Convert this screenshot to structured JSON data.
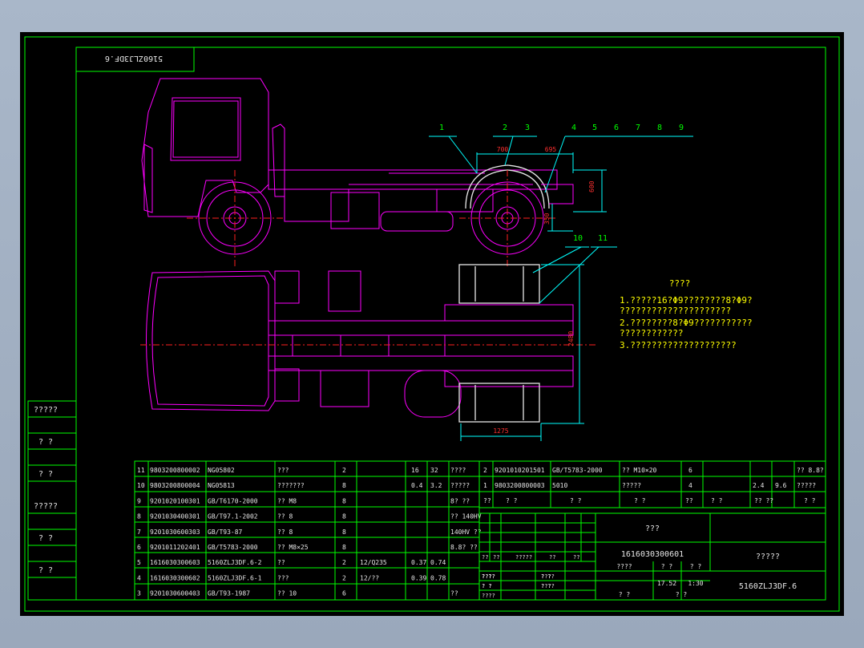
{
  "drawing_code_mirrored": "5160ZLJ3DF.6",
  "balloons_top": [
    "1",
    "2",
    "3",
    "4",
    "5",
    "6",
    "7",
    "8",
    "9"
  ],
  "balloons_plan": [
    "10",
    "11"
  ],
  "dims_side": [
    "700",
    "695",
    "600",
    "350"
  ],
  "dims_plan": [
    "2480",
    "1275"
  ],
  "notes": {
    "title": "????",
    "items": [
      "1.?????16?Φ9????????8?Φ9?",
      "  ?????????????????????",
      "2.????????8?Φ9???????????",
      "  ????????????",
      "3.????????????????????"
    ]
  },
  "left_strip": [
    "?????",
    "? ?",
    "? ?",
    "?????",
    "? ?",
    "? ?"
  ],
  "bom_left": [
    [
      "11",
      "9803200800002",
      "NG05802",
      "???",
      "2",
      "",
      "16",
      "32",
      "????"
    ],
    [
      "10",
      "9803200800004",
      "NG05813",
      "???????",
      "8",
      "",
      "0.4",
      "3.2",
      "?????"
    ],
    [
      "9",
      "9201020100301",
      "GB/T6170-2000",
      "?? M8",
      "8",
      "",
      "",
      "",
      "8? ??"
    ],
    [
      "8",
      "9201030400301",
      "GB/T97.1-2002",
      "?? 8",
      "8",
      "",
      "",
      "",
      "?? 140HV"
    ],
    [
      "7",
      "9201030600303",
      "GB/T93-87",
      "?? 8",
      "8",
      "",
      "",
      "",
      "140HV ??"
    ],
    [
      "6",
      "9201011202401",
      "GB/T5783-2000",
      "?? M8×25",
      "8",
      "",
      "",
      "",
      "8.8? ??"
    ],
    [
      "5",
      "1616030300603",
      "5160ZLJ3DF.6-2",
      "??",
      "2",
      "12/Q235",
      "0.37",
      "0.74",
      ""
    ],
    [
      "4",
      "1616030300602",
      "5160ZLJ3DF.6-1",
      "???",
      "2",
      "12/??",
      "0.39",
      "0.78",
      ""
    ],
    [
      "3",
      "9201030600403",
      "GB/T93-1987",
      "?? 10",
      "6",
      "",
      "",
      "",
      "??"
    ]
  ],
  "bom_right": [
    [
      "2",
      "9201010201501",
      "GB/T5783-2000",
      "?? M10×20",
      "6",
      "",
      "",
      "",
      "?? 8.8?"
    ],
    [
      "1",
      "9803200800003",
      "5010",
      "?????",
      "4",
      "",
      "2.4",
      "9.6",
      "?????"
    ],
    [
      "??",
      "? ?",
      "? ?",
      "? ?",
      "??",
      "? ?",
      "?? ??",
      "? ?"
    ]
  ],
  "title_block": {
    "name": "???",
    "part_no": "1616030300601",
    "company": "?????",
    "code": "5160ZLJ3DF.6",
    "weight": "17.52",
    "scale": "1:30",
    "labels_a": [
      "??",
      "??",
      "?????",
      "??",
      "??"
    ],
    "labels_b": [
      "? ?",
      "????",
      "? ?",
      "? ?",
      "????"
    ],
    "labels_c": [
      "????",
      "? ?",
      "? ?"
    ],
    "sheet": [
      "? ?",
      "? ?"
    ]
  },
  "colors": {
    "frame": "#00ff00",
    "truck": "#ff00ff",
    "leader": "#00ffff",
    "center": "#ff2020",
    "text": "#e6e6e6",
    "notes": "#ffff00"
  }
}
